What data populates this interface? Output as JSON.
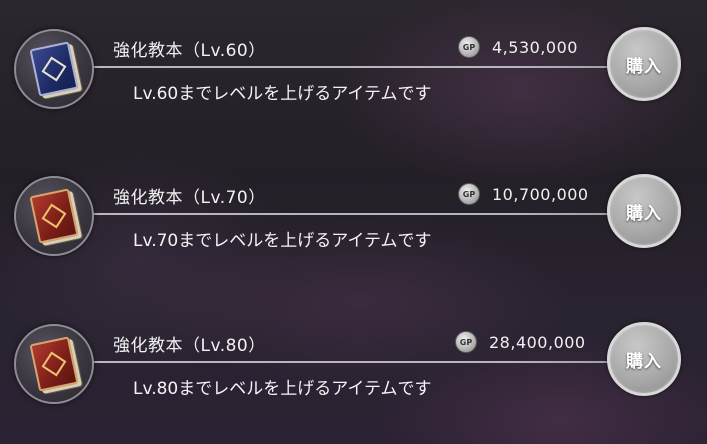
{
  "items": [
    {
      "name": "強化教本（Lv.60）",
      "description": "Lv.60までレベルを上げるアイテムです",
      "price": "4,530,000",
      "currency_icon": "gp-coin-icon",
      "currency_label": "GP",
      "book_color": "blue",
      "buy_label": "購入"
    },
    {
      "name": "強化教本（Lv.70）",
      "description": "Lv.70までレベルを上げるアイテムです",
      "price": "10,700,000",
      "currency_icon": "gp-coin-icon",
      "currency_label": "GP",
      "book_color": "red",
      "buy_label": "購入"
    },
    {
      "name": "強化教本（Lv.80）",
      "description": "Lv.80までレベルを上げるアイテムです",
      "price": "28,400,000",
      "currency_icon": "gp-coin-icon",
      "currency_label": "GP",
      "book_color": "red",
      "buy_label": "購入"
    }
  ],
  "colors": {
    "background": "#2a2430",
    "text": "#f2f2f2",
    "button": "#a9a9a9",
    "divider": "#c8c8cd"
  }
}
